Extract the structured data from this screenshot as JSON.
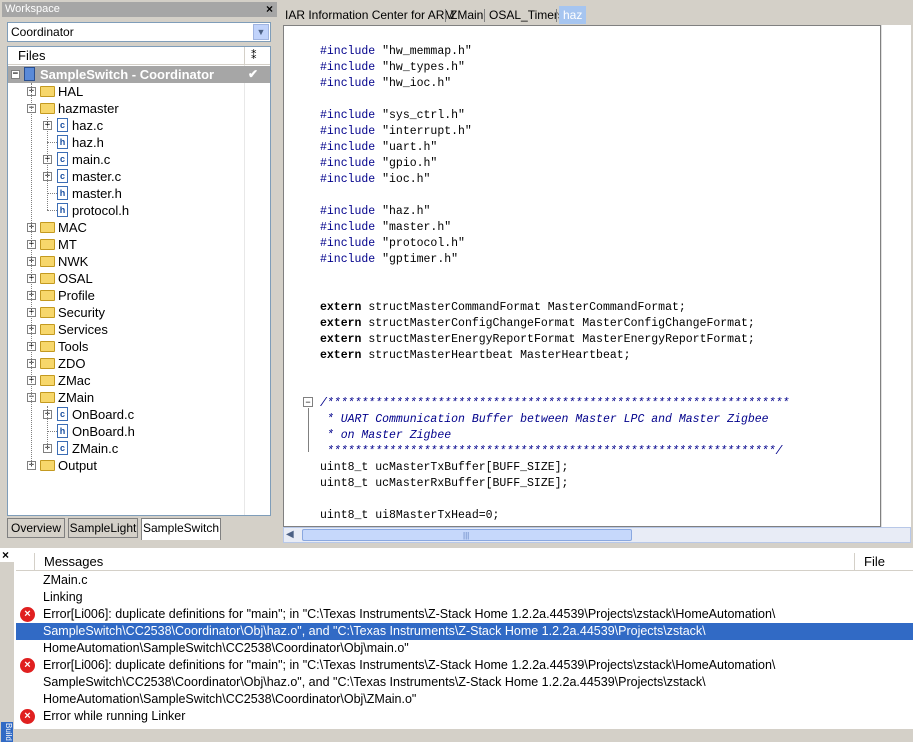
{
  "workspace": {
    "title": "Workspace",
    "close": "×",
    "configuration": "Coordinator",
    "files_header": "Files",
    "tree": [
      {
        "label": "SampleSwitch - Coordinator",
        "type": "root",
        "depth": 0,
        "expander": "−",
        "check": "✔"
      },
      {
        "label": "HAL",
        "type": "folder",
        "depth": 1,
        "expander": "+"
      },
      {
        "label": "hazmaster",
        "type": "folder",
        "depth": 1,
        "expander": "−"
      },
      {
        "label": "haz.c",
        "type": "cfile",
        "depth": 2,
        "expander": "+"
      },
      {
        "label": "haz.h",
        "type": "hfile",
        "depth": 2,
        "expander": ""
      },
      {
        "label": "main.c",
        "type": "cfile",
        "depth": 2,
        "expander": "+"
      },
      {
        "label": "master.c",
        "type": "cfile",
        "depth": 2,
        "expander": "+"
      },
      {
        "label": "master.h",
        "type": "hfile",
        "depth": 2,
        "expander": ""
      },
      {
        "label": "protocol.h",
        "type": "hfile",
        "depth": 2,
        "expander": ""
      },
      {
        "label": "MAC",
        "type": "folder",
        "depth": 1,
        "expander": "+"
      },
      {
        "label": "MT",
        "type": "folder",
        "depth": 1,
        "expander": "+"
      },
      {
        "label": "NWK",
        "type": "folder",
        "depth": 1,
        "expander": "+"
      },
      {
        "label": "OSAL",
        "type": "folder",
        "depth": 1,
        "expander": "+"
      },
      {
        "label": "Profile",
        "type": "folder",
        "depth": 1,
        "expander": "+"
      },
      {
        "label": "Security",
        "type": "folder",
        "depth": 1,
        "expander": "+"
      },
      {
        "label": "Services",
        "type": "folder",
        "depth": 1,
        "expander": "+"
      },
      {
        "label": "Tools",
        "type": "folder",
        "depth": 1,
        "expander": "+"
      },
      {
        "label": "ZDO",
        "type": "folder",
        "depth": 1,
        "expander": "+"
      },
      {
        "label": "ZMac",
        "type": "folder",
        "depth": 1,
        "expander": "+"
      },
      {
        "label": "ZMain",
        "type": "folder",
        "depth": 1,
        "expander": "−"
      },
      {
        "label": "OnBoard.c",
        "type": "cfile",
        "depth": 2,
        "expander": "+"
      },
      {
        "label": "OnBoard.h",
        "type": "hfile",
        "depth": 2,
        "expander": ""
      },
      {
        "label": "ZMain.c",
        "type": "cfile",
        "depth": 2,
        "expander": "+"
      },
      {
        "label": "Output",
        "type": "folder",
        "depth": 1,
        "expander": "+"
      }
    ],
    "tabs": [
      "Overview",
      "SampleLight",
      "SampleSwitch"
    ],
    "active_tab": "SampleSwitch"
  },
  "editor": {
    "tabs": [
      "IAR Information Center for ARM",
      "ZMain",
      "OSAL_Timers",
      "haz"
    ],
    "active_tab": "haz",
    "lines": [
      {
        "kind": "include",
        "kw": "#include",
        "rest": " \"hw_memmap.h\""
      },
      {
        "kind": "include",
        "kw": "#include",
        "rest": " \"hw_types.h\""
      },
      {
        "kind": "include",
        "kw": "#include",
        "rest": " \"hw_ioc.h\""
      },
      {
        "kind": "blank",
        "text": ""
      },
      {
        "kind": "include",
        "kw": "#include",
        "rest": " \"sys_ctrl.h\""
      },
      {
        "kind": "include",
        "kw": "#include",
        "rest": " \"interrupt.h\""
      },
      {
        "kind": "include",
        "kw": "#include",
        "rest": " \"uart.h\""
      },
      {
        "kind": "include",
        "kw": "#include",
        "rest": " \"gpio.h\""
      },
      {
        "kind": "include",
        "kw": "#include",
        "rest": " \"ioc.h\""
      },
      {
        "kind": "blank",
        "text": ""
      },
      {
        "kind": "include",
        "kw": "#include",
        "rest": " \"haz.h\""
      },
      {
        "kind": "include",
        "kw": "#include",
        "rest": " \"master.h\""
      },
      {
        "kind": "include",
        "kw": "#include",
        "rest": " \"protocol.h\""
      },
      {
        "kind": "include",
        "kw": "#include",
        "rest": " \"gptimer.h\""
      },
      {
        "kind": "blank",
        "text": ""
      },
      {
        "kind": "blank",
        "text": ""
      },
      {
        "kind": "extern",
        "kw": "extern",
        "rest": " structMasterCommandFormat MasterCommandFormat;"
      },
      {
        "kind": "extern",
        "kw": "extern",
        "rest": " structMasterConfigChangeFormat MasterConfigChangeFormat;"
      },
      {
        "kind": "extern",
        "kw": "extern",
        "rest": " structMasterEnergyReportFormat MasterEnergyReportFormat;"
      },
      {
        "kind": "extern",
        "kw": "extern",
        "rest": " structMasterHeartbeat MasterHeartbeat;"
      },
      {
        "kind": "blank",
        "text": ""
      },
      {
        "kind": "blank",
        "text": ""
      },
      {
        "kind": "comment",
        "text": "/*******************************************************************"
      },
      {
        "kind": "comment",
        "text": " * UART Communication Buffer between Master LPC and Master Zigbee"
      },
      {
        "kind": "comment",
        "text": " * on Master Zigbee"
      },
      {
        "kind": "comment",
        "text": " *****************************************************************/"
      },
      {
        "kind": "plain",
        "text": "uint8_t ucMasterTxBuffer[BUFF_SIZE];"
      },
      {
        "kind": "plain",
        "text": "uint8_t ucMasterRxBuffer[BUFF_SIZE];"
      },
      {
        "kind": "blank",
        "text": ""
      },
      {
        "kind": "plain",
        "text": "uint8_t ui8MasterTxHead=0;"
      }
    ],
    "fold_marker": "−"
  },
  "messages": {
    "close": "×",
    "header_messages": "Messages",
    "header_file": "File",
    "items": [
      {
        "text": "ZMain.c",
        "error": false,
        "selected": false
      },
      {
        "text": "Linking",
        "error": false,
        "selected": false
      },
      {
        "text": "Error[Li006]: duplicate definitions for \"main\"; in \"C:\\Texas Instruments\\Z-Stack Home 1.2.2a.44539\\Projects\\zstack\\HomeAutomation\\",
        "error": true,
        "selected": false
      },
      {
        "text": "SampleSwitch\\CC2538\\Coordinator\\Obj\\haz.o\", and \"C:\\Texas Instruments\\Z-Stack Home 1.2.2a.44539\\Projects\\zstack\\",
        "error": false,
        "selected": true
      },
      {
        "text": "HomeAutomation\\SampleSwitch\\CC2538\\Coordinator\\Obj\\main.o\"",
        "error": false,
        "selected": false
      },
      {
        "text": "Error[Li006]: duplicate definitions for \"main\"; in \"C:\\Texas Instruments\\Z-Stack Home 1.2.2a.44539\\Projects\\zstack\\HomeAutomation\\",
        "error": true,
        "selected": false
      },
      {
        "text": "SampleSwitch\\CC2538\\Coordinator\\Obj\\haz.o\", and \"C:\\Texas Instruments\\Z-Stack Home 1.2.2a.44539\\Projects\\zstack\\",
        "error": false,
        "selected": false
      },
      {
        "text": "HomeAutomation\\SampleSwitch\\CC2538\\Coordinator\\Obj\\ZMain.o\"",
        "error": false,
        "selected": false
      },
      {
        "text": "Error while running Linker",
        "error": true,
        "selected": false
      }
    ],
    "error_glyph": "×",
    "side_tab": "Build"
  }
}
